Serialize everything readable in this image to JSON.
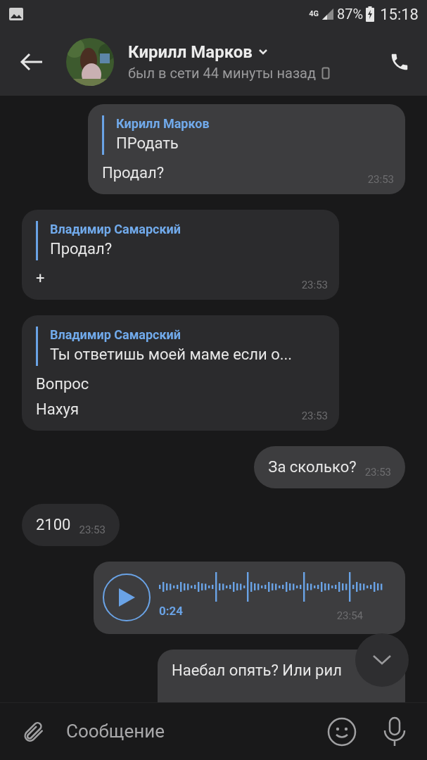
{
  "status_bar": {
    "network": "4G",
    "battery": "87%",
    "time": "15:18"
  },
  "header": {
    "name": "Кирилл Марков",
    "status": "был в сети 44 минуты назад"
  },
  "messages": [
    {
      "kind": "text",
      "outgoing": true,
      "quote": {
        "author": "Кирилл Марков",
        "text": "ПРодать"
      },
      "lines": [
        "Продал?"
      ],
      "time": "23:53"
    },
    {
      "kind": "text",
      "outgoing": false,
      "quote": {
        "author": "Владимир Самарский",
        "text": "Продал?"
      },
      "lines": [
        "+"
      ],
      "time": "23:53"
    },
    {
      "kind": "text",
      "outgoing": false,
      "quote": {
        "author": "Владимир Самарский",
        "text": "Ты ответишь моей маме если о..."
      },
      "lines": [
        "Вопрос",
        "Нахуя"
      ],
      "time": "23:53"
    },
    {
      "kind": "short",
      "outgoing": true,
      "lines": [
        "За сколько?"
      ],
      "time": "23:53"
    },
    {
      "kind": "short",
      "outgoing": false,
      "lines": [
        "2100"
      ],
      "time": "23:53"
    },
    {
      "kind": "voice",
      "outgoing": true,
      "duration": "0:24",
      "time": "23:54"
    },
    {
      "kind": "cut",
      "outgoing": true,
      "lines": [
        "Наебал опять? Или рил"
      ]
    }
  ],
  "composer": {
    "placeholder": "Сообщение"
  }
}
